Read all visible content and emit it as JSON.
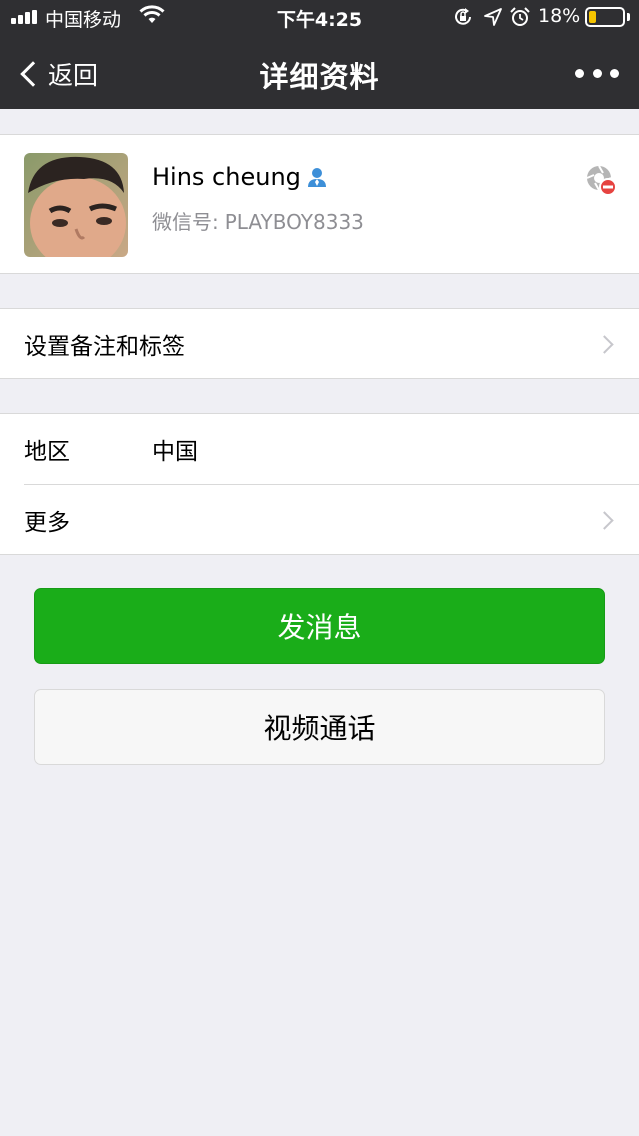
{
  "status_bar": {
    "carrier": "中国移动",
    "time": "下午4:25",
    "battery": "18%",
    "battery_level": 0.18,
    "icons": [
      "signal-icon",
      "wifi-icon",
      "orientation-lock-icon",
      "location-icon",
      "alarm-icon",
      "battery-icon"
    ]
  },
  "nav": {
    "back_label": "返回",
    "title": "详细资料",
    "more_icon": "more-dots-icon"
  },
  "profile": {
    "name": "Hins cheung",
    "wechat_id_label": "微信号:",
    "wechat_id": "PLAYBOY8333",
    "gender_icon": "male-icon",
    "status_icon": "blocked-moments-icon"
  },
  "settings": {
    "remark_label": "设置备注和标签"
  },
  "info": {
    "region_label": "地区",
    "region_value": "中国",
    "more_label": "更多"
  },
  "actions": {
    "message_label": "发消息",
    "video_call_label": "视频通话"
  },
  "colors": {
    "nav_bg": "#2f2f32",
    "page_bg": "#efeff4",
    "primary": "#1aad19",
    "battery": "#f5c400",
    "gender": "#3d8fd8",
    "status_badge": "#e64340"
  }
}
